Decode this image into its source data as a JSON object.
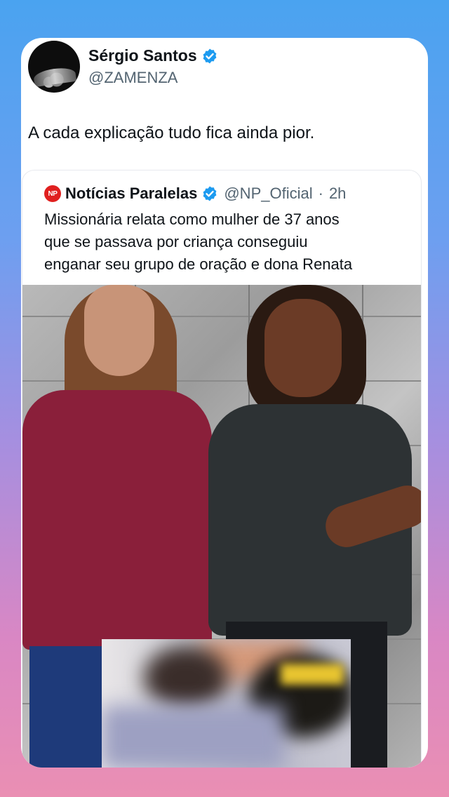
{
  "tweet": {
    "author_name": "Sérgio Santos",
    "author_handle": "@ZAMENZA",
    "verified": true,
    "text": "A cada explicação tudo fica ainda pior."
  },
  "quoted_tweet": {
    "logo_text": "NP",
    "author_name": "Notícias Paralelas",
    "verified": true,
    "author_handle": "@NP_Oficial",
    "separator": "·",
    "time": "2h",
    "text_lines": [
      "Missionária relata como mulher de 37 anos",
      "que se passava por criança conseguiu",
      "enganar seu grupo de oração e dona Renata"
    ]
  },
  "colors": {
    "verified_blue": "#1d9bf0",
    "np_red": "#e0201f",
    "background_top": "#4aa3f0",
    "background_bottom": "#ea8fb3"
  },
  "icons": {
    "verified": "verified-badge-icon",
    "np_logo": "np-logo-icon"
  }
}
